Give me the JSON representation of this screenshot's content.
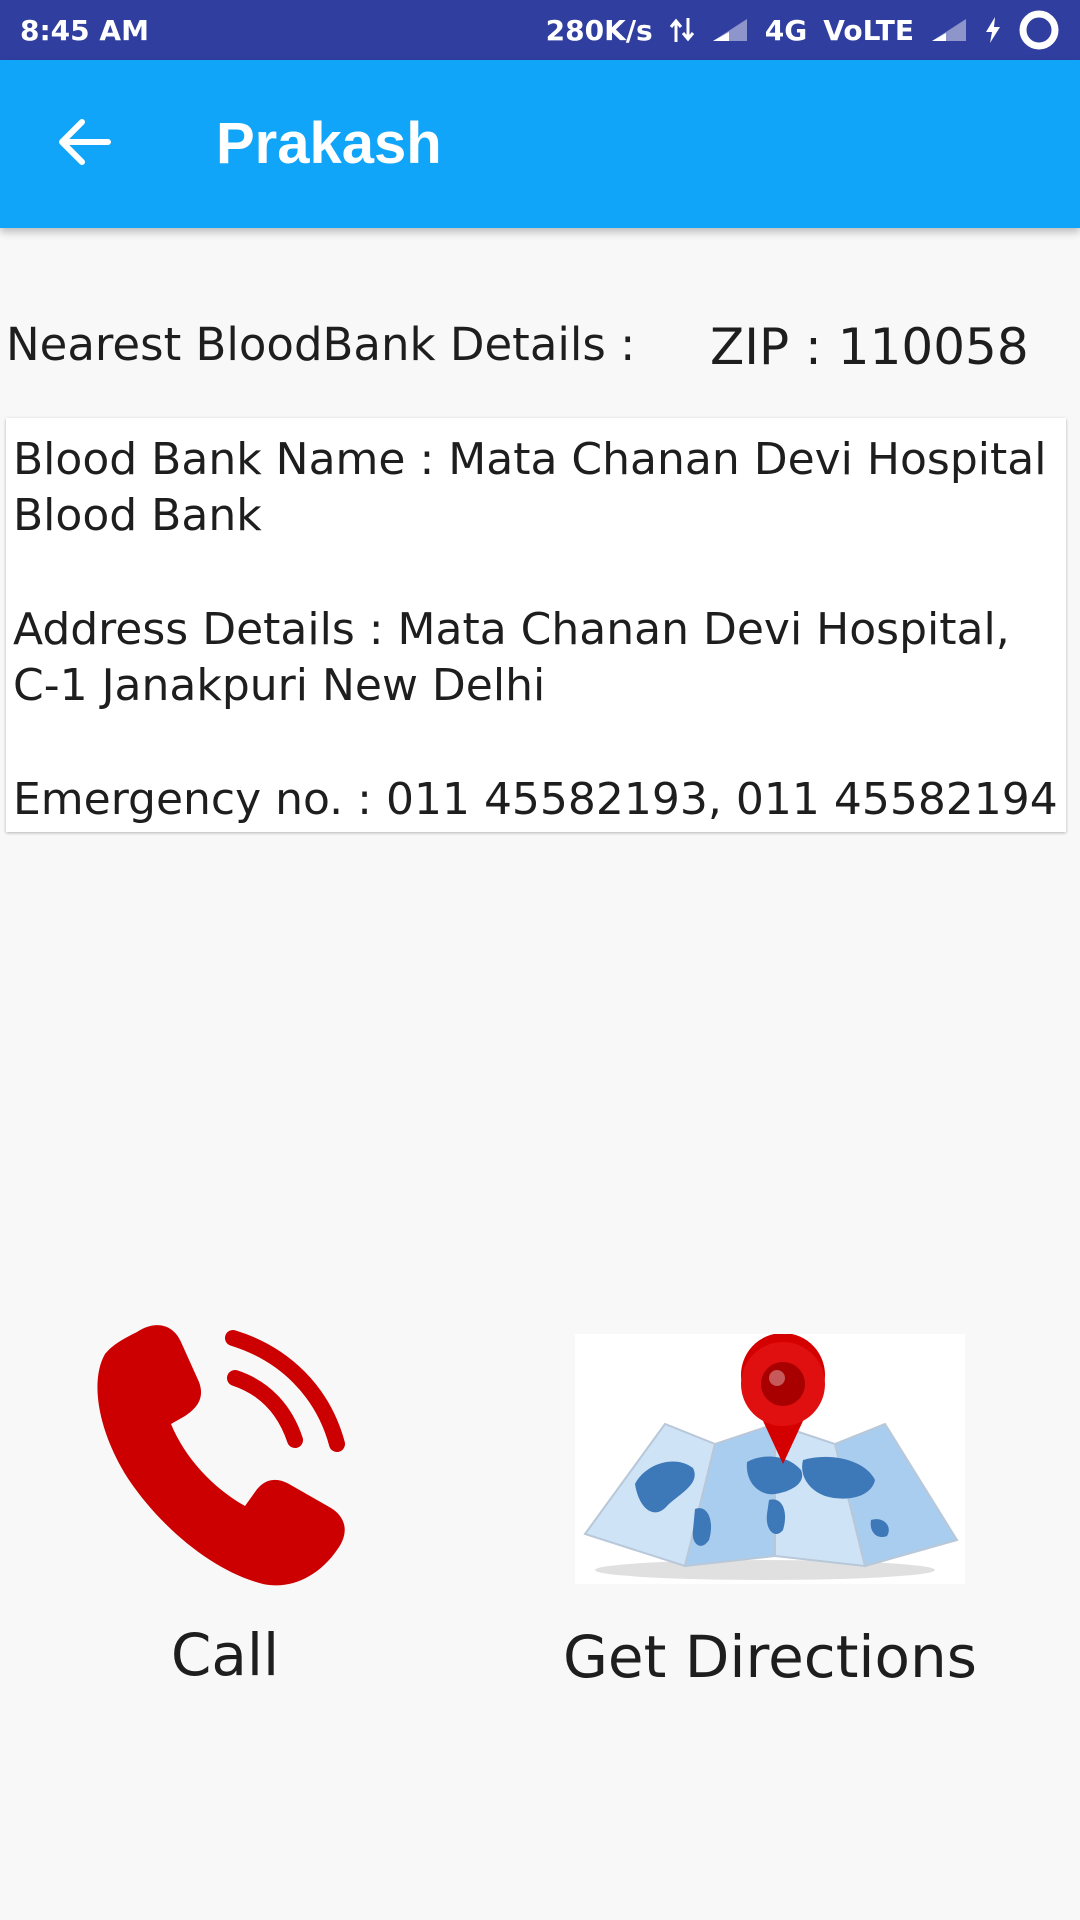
{
  "status_bar": {
    "time": "8:45 AM",
    "net_speed": "280K/s",
    "network": "4G",
    "volte": "VoLTE"
  },
  "app_bar": {
    "title": "Prakash",
    "back_icon": "arrow-back-icon"
  },
  "header": {
    "section_label": "Nearest BloodBank Details :",
    "zip": "ZIP : 110058"
  },
  "details": {
    "blood_bank_name": "Blood Bank Name : Mata Chanan Devi Hospital Blood Bank",
    "address": "Address Details : Mata Chanan Devi Hospital, C-1 Janakpuri New Delhi",
    "emergency": "Emergency no. : 011 45582193, 011 45582194"
  },
  "actions": {
    "call_label": "Call",
    "call_icon": "phone-icon",
    "directions_label": "Get Directions",
    "directions_icon": "map-pin-icon"
  },
  "colors": {
    "status_bar": "#303f9f",
    "app_bar": "#11a5f9",
    "phone_red": "#cc0000",
    "background": "#f8f8f8"
  }
}
